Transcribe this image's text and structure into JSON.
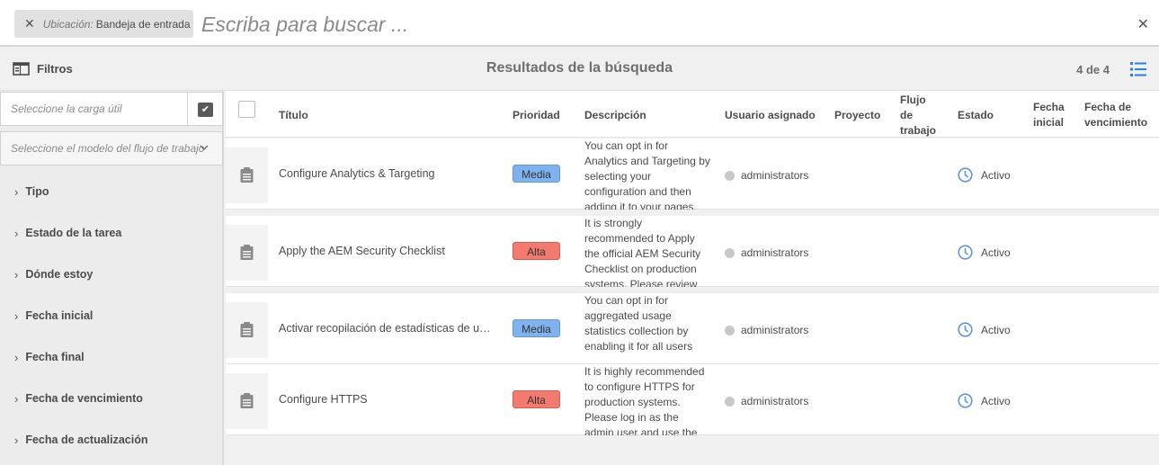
{
  "search": {
    "location_label": "Ubicación:",
    "location_value": "Bandeja de entrada",
    "placeholder": "Escriba para buscar ..."
  },
  "results_bar": {
    "filters_label": "Filtros",
    "title": "Resultados de la búsqueda",
    "count": "4 de 4"
  },
  "sidebar": {
    "payload_placeholder": "Seleccione la carga útil",
    "model_placeholder": "Seleccione el modelo del flujo de trabajo",
    "filters": [
      "Tipo",
      "Estado de la tarea",
      "Dónde estoy",
      "Fecha inicial",
      "Fecha final",
      "Fecha de vencimiento",
      "Fecha de actualización"
    ]
  },
  "table": {
    "columns": {
      "title": "Título",
      "priority": "Prioridad",
      "description": "Descripción",
      "assignee": "Usuario asignado",
      "project": "Proyecto",
      "workflow_l1": "Flujo",
      "workflow_l2": "de",
      "workflow_l3": "trabajo",
      "status": "Estado",
      "start_l1": "Fecha",
      "start_l2": "inicial",
      "due_l1": "Fecha de",
      "due_l2": "vencimiento"
    },
    "rows": [
      {
        "title": "Configure Analytics & Targeting",
        "priority": "Media",
        "description": "You can opt in for Analytics and Targeting by selecting your configuration and then adding it to your pages.",
        "assignee": "administrators",
        "status": "Activo"
      },
      {
        "title": "Apply the AEM Security Checklist",
        "priority": "Alta",
        "description": "It is strongly recommended to Apply the official AEM Security Checklist on production systems. Please review",
        "assignee": "administrators",
        "status": "Activo"
      },
      {
        "title": "Activar recopilación de estadísticas de uso a...",
        "priority": "Media",
        "description": "You can opt in for aggregated usage statistics collection by enabling it for all users",
        "assignee": "administrators",
        "status": "Activo"
      },
      {
        "title": "Configure HTTPS",
        "priority": "Alta",
        "description": "It is highly recommended to configure HTTPS for production systems. Please log in as the admin user and use the SSL",
        "assignee": "administrators",
        "status": "Activo"
      }
    ]
  },
  "colors": {
    "priority_media": "#7eb3f0",
    "priority_alta": "#f27a6e",
    "status_icon": "#5d95d8"
  }
}
